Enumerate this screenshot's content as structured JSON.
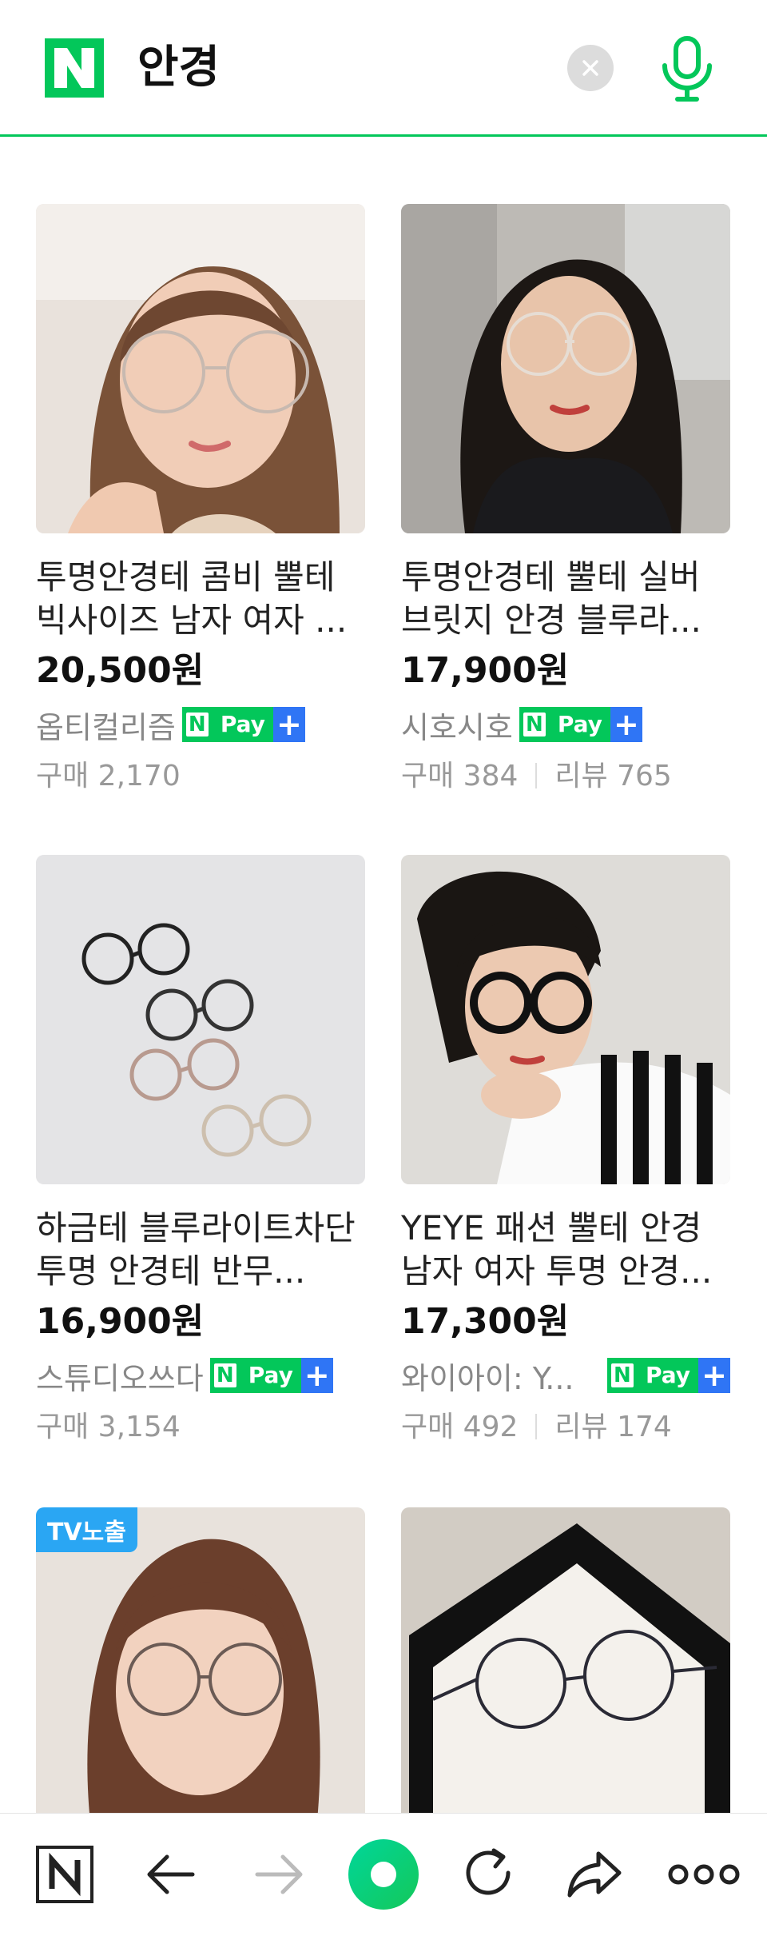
{
  "search": {
    "query": "안경",
    "logo_letter": "N"
  },
  "pay_badge": {
    "n": "N",
    "pay": "Pay",
    "plus": "+"
  },
  "products": [
    {
      "title": "투명안경테 콤비 뿔테 빅사이즈 남자 여자 ...",
      "price": "20,500원",
      "store": "옵티컬리즘",
      "purchases": "구매 2,170",
      "reviews": "",
      "badge": ""
    },
    {
      "title": "투명안경테 뿔테 실버 브릿지 안경 블루라...",
      "price": "17,900원",
      "store": "시호시호",
      "purchases": "구매 384",
      "reviews": "리뷰 765",
      "badge": ""
    },
    {
      "title": "하금테 블루라이트차단 투명 안경테 반무...",
      "price": "16,900원",
      "store": "스튜디오쓰다",
      "purchases": "구매 3,154",
      "reviews": "",
      "badge": ""
    },
    {
      "title": "YEYE 패션 뿔테 안경 남자 여자 투명 안경...",
      "price": "17,300원",
      "store": "와이아이: Y...",
      "purchases": "구매 492",
      "reviews": "리뷰 174",
      "badge": ""
    },
    {
      "title": "",
      "price": "",
      "store": "",
      "purchases": "",
      "reviews": "",
      "badge": "TV노출"
    },
    {
      "title": "",
      "price": "",
      "store": "",
      "purchases": "",
      "reviews": "",
      "badge": ""
    }
  ],
  "icons": [
    "naver-logo-icon",
    "clear-icon",
    "mic-icon",
    "home-n-icon",
    "back-icon",
    "forward-icon",
    "green-dot-icon",
    "refresh-icon",
    "share-icon",
    "more-icon"
  ],
  "colors": {
    "brand": "#03c75a",
    "plus_blue": "#2f75f5",
    "tv_badge": "#2aa6f3"
  }
}
